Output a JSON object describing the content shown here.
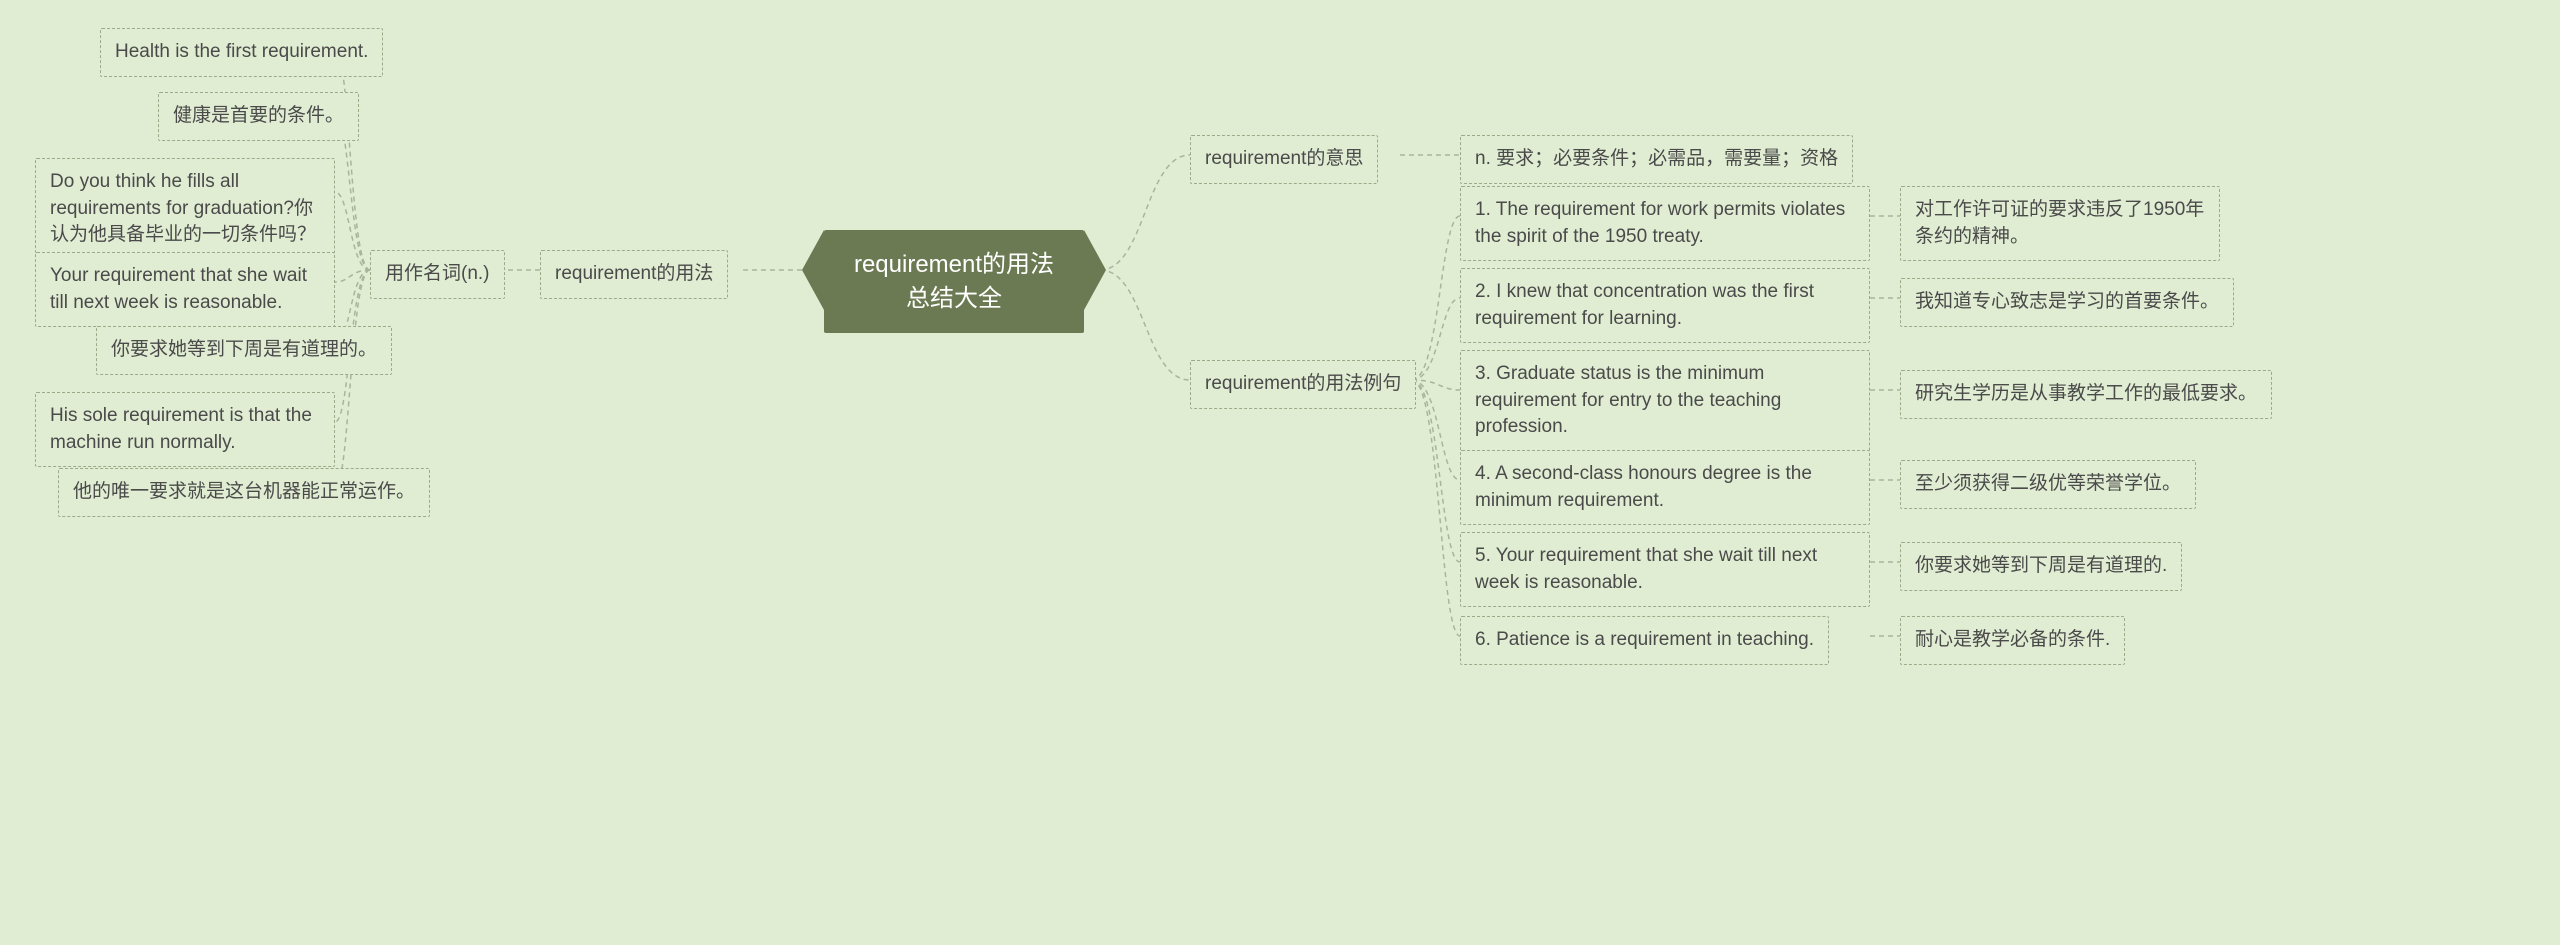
{
  "root": {
    "title": "requirement的用法总结大全"
  },
  "left": {
    "usage": {
      "label": "requirement的用法",
      "noun": {
        "label": "用作名词(n.)",
        "examples": [
          "Health is the first requirement.",
          "健康是首要的条件。",
          "Do you think he fills all requirements for graduation?你认为他具备毕业的一切条件吗？",
          "Your requirement that she wait till next week is reasonable.",
          "你要求她等到下周是有道理的。",
          "His sole requirement is that the machine run normally.",
          "他的唯一要求就是这台机器能正常运作。"
        ]
      }
    }
  },
  "right": {
    "meaning": {
      "label": "requirement的意思",
      "text": "n. 要求；必要条件；必需品，需要量；资格"
    },
    "examples": {
      "label": "requirement的用法例句",
      "items": [
        {
          "en": "1. The requirement for work permits violates the spirit of the 1950 treaty.",
          "zh": "对工作许可证的要求违反了1950年条约的精神。"
        },
        {
          "en": "2. I knew that concentration was the first requirement for learning.",
          "zh": "我知道专心致志是学习的首要条件。"
        },
        {
          "en": "3. Graduate status is the minimum requirement for entry to the teaching profession.",
          "zh": "研究生学历是从事教学工作的最低要求。"
        },
        {
          "en": "4. A second-class honours degree is the minimum requirement.",
          "zh": "至少须获得二级优等荣誉学位。"
        },
        {
          "en": "5. Your requirement that she wait till next week is reasonable.",
          "zh": "你要求她等到下周是有道理的."
        },
        {
          "en": "6. Patience is a requirement in teaching.",
          "zh": "耐心是教学必备的条件."
        }
      ]
    }
  }
}
